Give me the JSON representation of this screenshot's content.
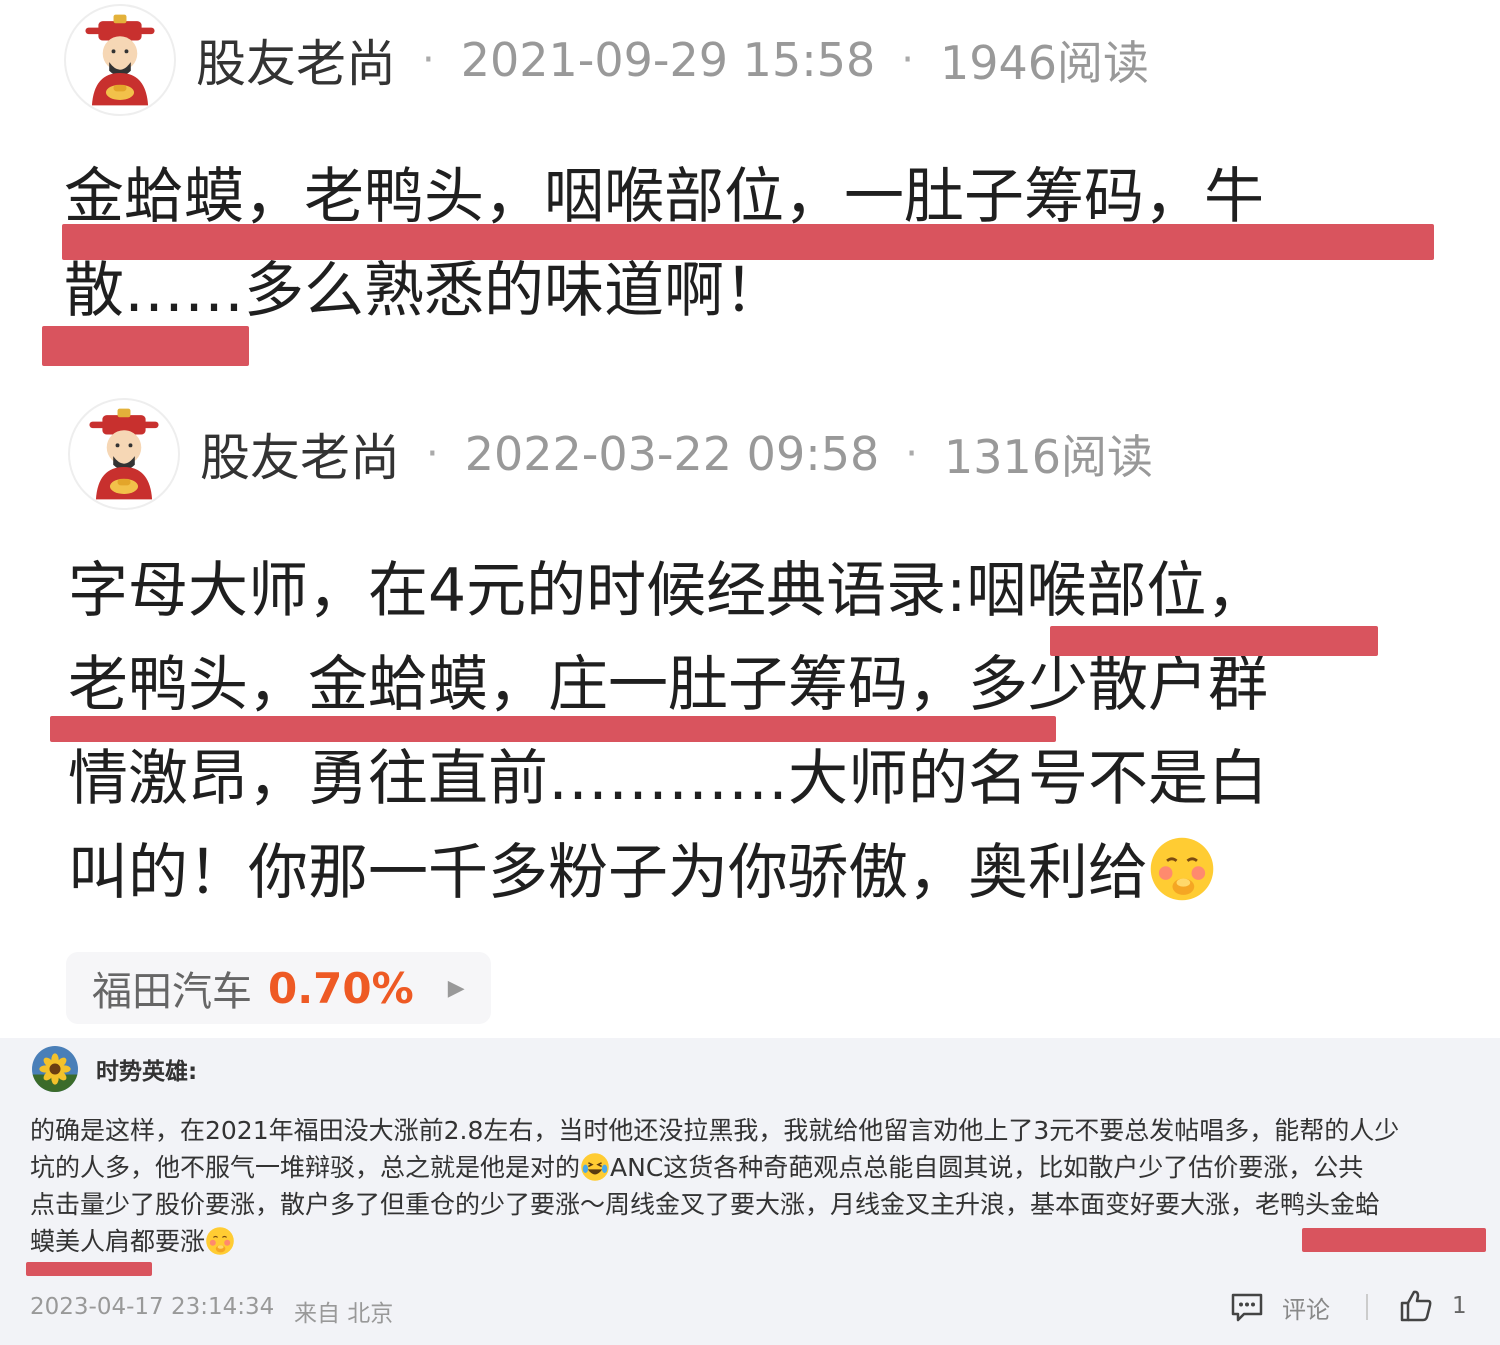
{
  "posts": [
    {
      "author": "股友老尚",
      "date": "2021-09-29 15:58",
      "reads": "1946阅读",
      "lines": [
        "金蛤蟆，老鸭头，咽喉部位，一肚子筹码，牛",
        "散……多么熟悉的味道啊！"
      ]
    },
    {
      "author": "股友老尚",
      "date": "2022-03-22 09:58",
      "reads": "1316阅读",
      "lines": [
        "字母大师，在4元的时候经典语录:咽喉部位，",
        "老鸭头，金蛤蟆，庄一肚子筹码，多少散户群",
        "情激昂，勇往直前…………大师的名号不是白",
        "叫的！你那一千多粉子为你骄傲，奥利给"
      ]
    }
  ],
  "stock": {
    "name": "福田汽车",
    "change": "0.70%"
  },
  "comment": {
    "user": "时势英雄:",
    "lines": [
      "的确是这样，在2021年福田没大涨前2.8左右，当时他还没拉黑我，我就给他留言劝他上了3元不要总发帖唱多，能帮的人少",
      "坑的人多，他不服气一堆辩驳，总之就是他是对的",
      "ANC这货各种奇葩观点总能自圆其说，比如散户少了估价要涨，公共",
      "点击量少了股价要涨，散户多了但重仓的少了要涨～周线金叉了要大涨，月线金叉主升浪，基本面变好要大涨，老鸭头金蛤",
      "蟆美人肩都要涨"
    ],
    "timestamp": "2023-04-17 23:14:34",
    "location": "来自 北京",
    "reply_label": "评论",
    "like_count": "1"
  },
  "colors": {
    "highlight": "#d9545e",
    "stock_up": "#ee5a24",
    "comment_bg": "#f2f3f7"
  },
  "icons": [
    "caishen-avatar",
    "sunflower-avatar",
    "laughing-crying-emoji",
    "shy-smile-emoji",
    "comment-icon",
    "thumbs-up-icon",
    "play-triangle-icon"
  ]
}
